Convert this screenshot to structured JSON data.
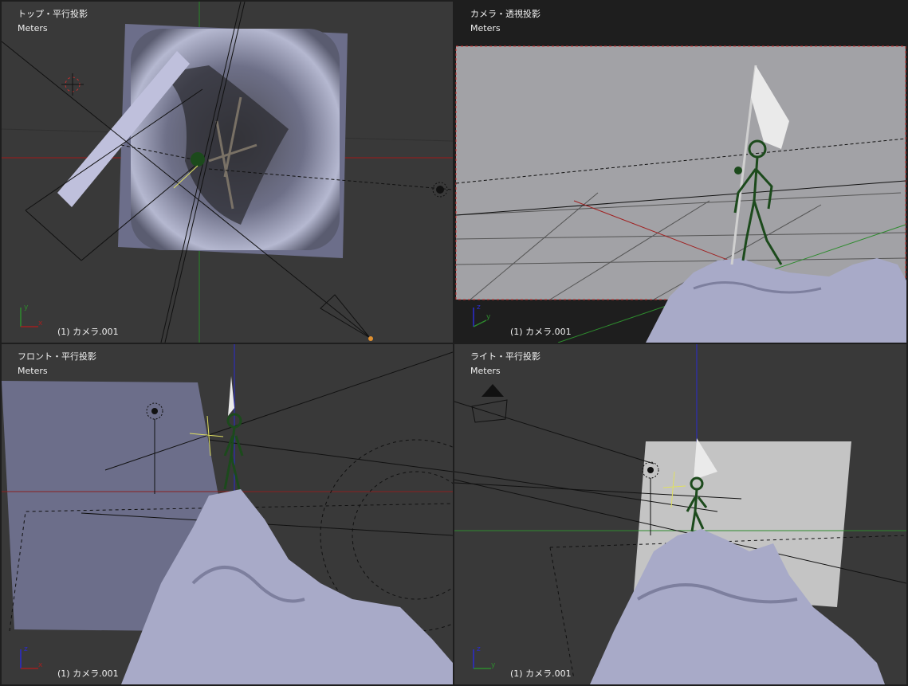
{
  "viewports": {
    "top": {
      "title": "トップ・平行投影",
      "units": "Meters",
      "status": "(1) カメラ.001",
      "axes": [
        "x",
        "y"
      ]
    },
    "camera": {
      "title": "カメラ・透視投影",
      "units": "Meters",
      "status": "(1) カメラ.001",
      "axes": [
        "y",
        "z"
      ]
    },
    "front": {
      "title": "フロント・平行投影",
      "units": "Meters",
      "status": "(1) カメラ.001",
      "axes": [
        "x",
        "z"
      ]
    },
    "right": {
      "title": "ライト・平行投影",
      "units": "Meters",
      "status": "(1) カメラ.001",
      "axes": [
        "y",
        "z"
      ]
    }
  },
  "colors": {
    "background": "#393939",
    "border": "#1e1e1e",
    "x_axis": "#a02020",
    "y_axis": "#2e8b2e",
    "z_axis": "#2b2bd0",
    "terrain": "#a8aac8",
    "armature": "#1c4a1c",
    "camera_view": "#a2a2a6"
  }
}
